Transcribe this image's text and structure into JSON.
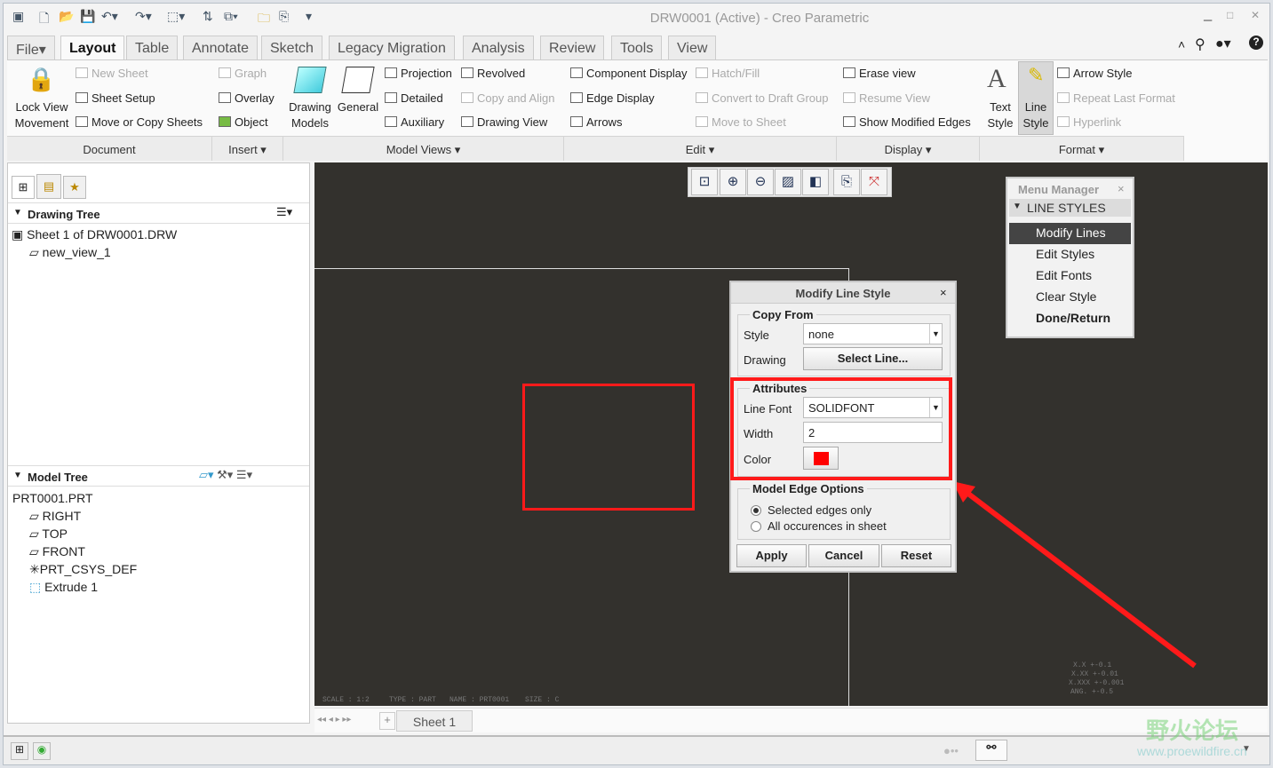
{
  "window": {
    "title": "DRW0001 (Active) - Creo Parametric"
  },
  "tabs": [
    {
      "label": "File"
    },
    {
      "label": "Layout",
      "active": true
    },
    {
      "label": "Table"
    },
    {
      "label": "Annotate"
    },
    {
      "label": "Sketch"
    },
    {
      "label": "Legacy Migration"
    },
    {
      "label": "Analysis"
    },
    {
      "label": "Review"
    },
    {
      "label": "Tools"
    },
    {
      "label": "View"
    }
  ],
  "ribbon": {
    "document": {
      "label": "Document",
      "lock_view": "Lock View",
      "movement": "Movement",
      "new_sheet": "New Sheet",
      "sheet_setup": "Sheet Setup",
      "move_copy": "Move or Copy Sheets"
    },
    "insert": {
      "label": "Insert",
      "graph": "Graph",
      "overlay": "Overlay",
      "object": "Object"
    },
    "model_views": {
      "label": "Model Views",
      "drawing": "Drawing",
      "models": "Models",
      "general": "General",
      "projection": "Projection",
      "detailed": "Detailed",
      "auxiliary": "Auxiliary",
      "revolved": "Revolved",
      "copy_align": "Copy and Align",
      "drawing_view": "Drawing View"
    },
    "edit": {
      "label": "Edit",
      "component_display": "Component Display",
      "edge_display": "Edge Display",
      "arrows": "Arrows",
      "hatch_fill": "Hatch/Fill",
      "convert": "Convert to Draft Group",
      "move_to_sheet": "Move to Sheet"
    },
    "display": {
      "label": "Display",
      "erase_view": "Erase view",
      "resume_view": "Resume View",
      "show_modified": "Show Modified Edges"
    },
    "format": {
      "label": "Format",
      "text": "Text",
      "text_style": "Style",
      "line": "Line",
      "line_style": "Style",
      "arrow_style": "Arrow Style",
      "repeat_last": "Repeat Last Format",
      "hyperlink": "Hyperlink"
    }
  },
  "drawing_tree": {
    "title": "Drawing Tree",
    "items": [
      "Sheet 1 of DRW0001.DRW",
      "new_view_1"
    ]
  },
  "model_tree": {
    "title": "Model Tree",
    "items": [
      "PRT0001.PRT",
      "RIGHT",
      "TOP",
      "FRONT",
      "PRT_CSYS_DEF",
      "Extrude 1"
    ]
  },
  "menu_manager": {
    "title": "Menu Manager",
    "section": "LINE STYLES",
    "items": [
      "Modify Lines",
      "Edit Styles",
      "Edit Fonts",
      "Clear Style",
      "Done/Return"
    ],
    "selected": "Modify Lines"
  },
  "dialog": {
    "title": "Modify Line Style",
    "copy_from": "Copy From",
    "style_label": "Style",
    "style_value": "none",
    "drawing_label": "Drawing",
    "select_line": "Select Line...",
    "attributes": "Attributes",
    "line_font_label": "Line Font",
    "line_font_value": "SOLIDFONT",
    "width_label": "Width",
    "width_value": "2",
    "color_label": "Color",
    "color_value": "#ff0000",
    "edge_options": "Model Edge Options",
    "opt_selected": "Selected edges only",
    "opt_all": "All occurences in sheet",
    "apply": "Apply",
    "cancel": "Cancel",
    "reset": "Reset"
  },
  "drawing_info": {
    "scale": "SCALE : 1:2",
    "type": "TYPE : PART",
    "name": "NAME : PRT0001",
    "size": "SIZE : C",
    "tol": [
      "X.X  +-0.1",
      "X.XX  +-0.01",
      "X.XXX +-0.001",
      "ANG.  +-0.5"
    ]
  },
  "sheet_tabs": {
    "add": "+",
    "sheet": "Sheet 1"
  },
  "watermark": {
    "cn": "野火论坛",
    "url": "www.proewildfire.cn"
  },
  "colors": {
    "annotation": "#ff1a1a",
    "canvas": "#33312d"
  }
}
